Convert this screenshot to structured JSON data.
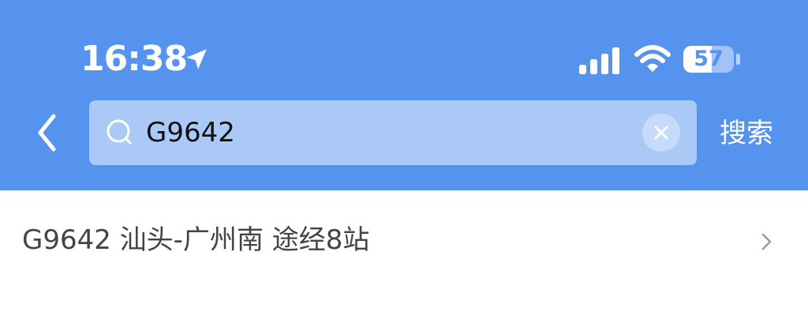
{
  "status_bar": {
    "time": "16:38",
    "battery_level": "57",
    "battery_fraction": 0.57,
    "icons": [
      "location-arrow-icon",
      "signal-icon",
      "wifi-icon",
      "battery-icon"
    ]
  },
  "search": {
    "query": "G9642",
    "placeholder": "",
    "submit_label": "搜索"
  },
  "results": [
    {
      "text": "G9642 汕头-广州南 途经8站",
      "icon": "chevron-right-icon"
    }
  ],
  "colors": {
    "header_bg": "#5593ee",
    "search_box_bg": "#aac9f7",
    "result_text": "#444444"
  }
}
